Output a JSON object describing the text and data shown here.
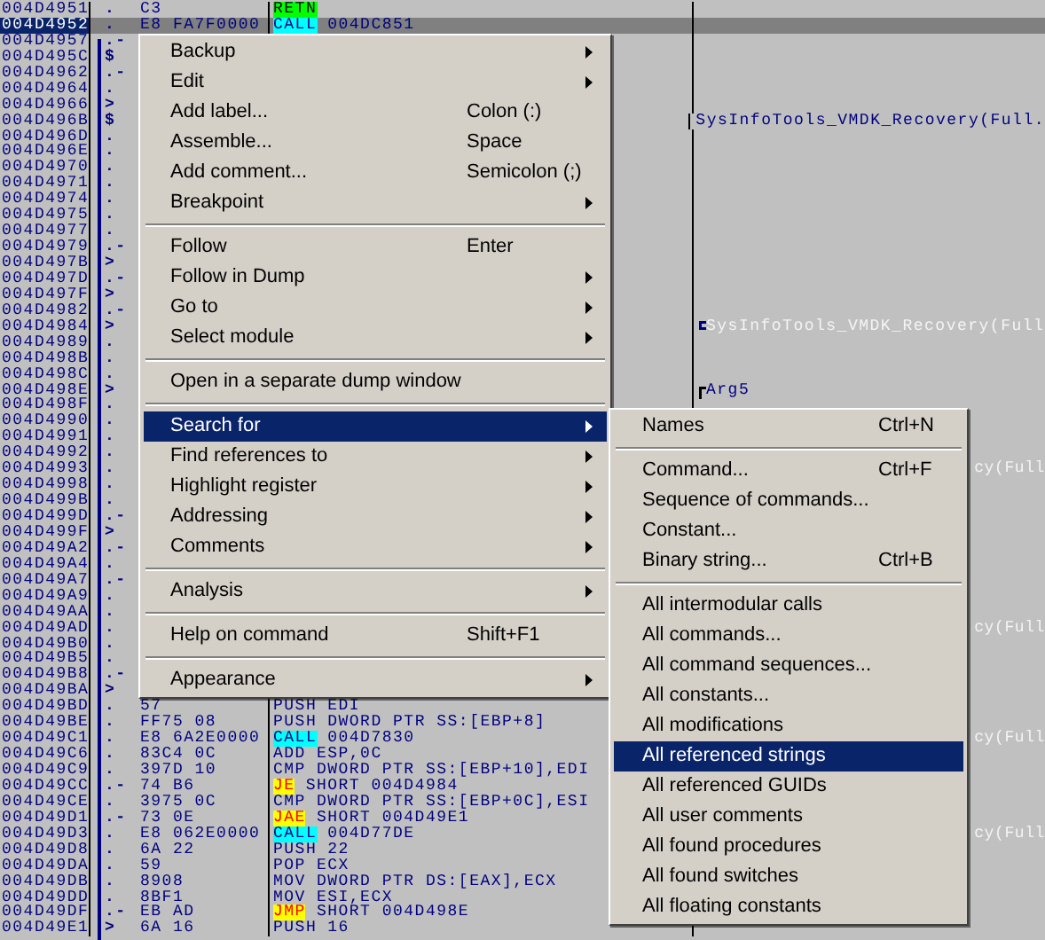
{
  "listing": {
    "rows": [
      {
        "address": "004D4951",
        "mark": ".",
        "hex": "C3",
        "mnemonic": "RETN",
        "operand": "",
        "kind": "ret",
        "selected": false
      },
      {
        "address": "004D4952",
        "mark": ".",
        "hex": "E8 FA7F0000",
        "mnemonic": "CALL",
        "operand": "004DC851",
        "kind": "call",
        "selected": true
      },
      {
        "address": "004D4957",
        "mark": ".-",
        "selected": false
      },
      {
        "address": "004D495C",
        "mark": "$",
        "selected": false
      },
      {
        "address": "004D4962",
        "mark": ".-",
        "selected": false
      },
      {
        "address": "004D4964",
        "mark": ".",
        "selected": false
      },
      {
        "address": "004D4966",
        "mark": ">",
        "selected": false
      },
      {
        "address": "004D496B",
        "mark": "$",
        "comment": {
          "text": "SysInfoTools_VMDK_Recovery(Full.",
          "kind": "label"
        },
        "selected": false
      },
      {
        "address": "004D496D",
        "mark": ".",
        "selected": false
      },
      {
        "address": "004D496E",
        "mark": ".",
        "selected": false
      },
      {
        "address": "004D4970",
        "mark": ".",
        "selected": false
      },
      {
        "address": "004D4971",
        "mark": ".",
        "selected": false
      },
      {
        "address": "004D4974",
        "mark": ".",
        "selected": false
      },
      {
        "address": "004D4975",
        "mark": ".",
        "selected": false
      },
      {
        "address": "004D4977",
        "mark": ".",
        "selected": false
      },
      {
        "address": "004D4979",
        "mark": ".-",
        "selected": false
      },
      {
        "address": "004D497B",
        "mark": ">",
        "selected": false
      },
      {
        "address": "004D497D",
        "mark": ".-",
        "selected": false
      },
      {
        "address": "004D497F",
        "mark": ">",
        "selected": false
      },
      {
        "address": "004D4982",
        "mark": ".-",
        "selected": false
      },
      {
        "address": "004D4984",
        "mark": ">",
        "comment": {
          "text": "SysInfoTools_VMDK_Recovery(Full",
          "kind": "call"
        },
        "selected": false
      },
      {
        "address": "004D4989",
        "mark": ".",
        "selected": false
      },
      {
        "address": "004D498B",
        "mark": ".",
        "selected": false
      },
      {
        "address": "004D498C",
        "mark": ".",
        "selected": false
      },
      {
        "address": "004D498E",
        "mark": ">",
        "comment": {
          "text": "Arg5",
          "kind": "arg"
        },
        "selected": false
      },
      {
        "address": "004D498F",
        "mark": ".",
        "selected": false
      },
      {
        "address": "004D4990",
        "mark": ".",
        "selected": false
      },
      {
        "address": "004D4991",
        "mark": ".",
        "selected": false
      },
      {
        "address": "004D4992",
        "mark": ".",
        "selected": false
      },
      {
        "address": "004D4993",
        "mark": ".",
        "comment": {
          "text": "cy(Full",
          "kind": "tail"
        },
        "selected": false
      },
      {
        "address": "004D4998",
        "mark": ".",
        "selected": false
      },
      {
        "address": "004D499B",
        "mark": ".",
        "selected": false
      },
      {
        "address": "004D499D",
        "mark": ".-",
        "selected": false
      },
      {
        "address": "004D499F",
        "mark": ">",
        "selected": false
      },
      {
        "address": "004D49A2",
        "mark": ".-",
        "selected": false
      },
      {
        "address": "004D49A4",
        "mark": ".",
        "selected": false
      },
      {
        "address": "004D49A7",
        "mark": ".-",
        "selected": false
      },
      {
        "address": "004D49A9",
        "mark": ".",
        "selected": false
      },
      {
        "address": "004D49AA",
        "mark": ".",
        "selected": false
      },
      {
        "address": "004D49AD",
        "mark": ".",
        "comment": {
          "text": "cy(Full",
          "kind": "tail"
        },
        "selected": false
      },
      {
        "address": "004D49B0",
        "mark": ".",
        "selected": false
      },
      {
        "address": "004D49B5",
        "mark": ".",
        "selected": false
      },
      {
        "address": "004D49B8",
        "mark": ".-",
        "selected": false
      },
      {
        "address": "004D49BA",
        "mark": ">",
        "selected": false
      },
      {
        "address": "004D49BD",
        "mark": ".",
        "hex": "57",
        "mnemonic": "PUSH",
        "operand": "EDI",
        "kind": "plain",
        "selected": false
      },
      {
        "address": "004D49BE",
        "mark": ".",
        "hex": "FF75 08",
        "mnemonic": "PUSH",
        "operand": "DWORD PTR SS:[EBP+8]",
        "kind": "plain",
        "selected": false
      },
      {
        "address": "004D49C1",
        "mark": ".",
        "hex": "E8 6A2E0000",
        "mnemonic": "CALL",
        "operand": "004D7830",
        "kind": "call",
        "comment": {
          "text": "cy(Full",
          "kind": "tail"
        },
        "selected": false
      },
      {
        "address": "004D49C6",
        "mark": ".",
        "hex": "83C4 0C",
        "mnemonic": "ADD",
        "operand": "ESP,0C",
        "kind": "plain",
        "selected": false
      },
      {
        "address": "004D49C9",
        "mark": ".",
        "hex": "397D 10",
        "mnemonic": "CMP",
        "operand": "DWORD PTR SS:[EBP+10],EDI",
        "kind": "plain",
        "selected": false
      },
      {
        "address": "004D49CC",
        "mark": ".-",
        "hex": "74 B6",
        "mnemonic": "JE",
        "operand": "SHORT 004D4984",
        "kind": "jump",
        "selected": false
      },
      {
        "address": "004D49CE",
        "mark": ".",
        "hex": "3975 0C",
        "mnemonic": "CMP",
        "operand": "DWORD PTR SS:[EBP+0C],ESI",
        "kind": "plain",
        "selected": false
      },
      {
        "address": "004D49D1",
        "mark": ".-",
        "hex": "73 0E",
        "mnemonic": "JAE",
        "operand": "SHORT 004D49E1",
        "kind": "jump",
        "selected": false
      },
      {
        "address": "004D49D3",
        "mark": ".",
        "hex": "E8 062E0000",
        "mnemonic": "CALL",
        "operand": "004D77DE",
        "kind": "call",
        "comment": {
          "text": "cy(Full",
          "kind": "tail"
        },
        "selected": false
      },
      {
        "address": "004D49D8",
        "mark": ".",
        "hex": "6A 22",
        "mnemonic": "PUSH",
        "operand": "22",
        "kind": "plain",
        "selected": false
      },
      {
        "address": "004D49DA",
        "mark": ".",
        "hex": "59",
        "mnemonic": "POP",
        "operand": "ECX",
        "kind": "plain",
        "selected": false
      },
      {
        "address": "004D49DB",
        "mark": ".",
        "hex": "8908",
        "mnemonic": "MOV",
        "operand": "DWORD PTR DS:[EAX],ECX",
        "kind": "plain",
        "selected": false
      },
      {
        "address": "004D49DD",
        "mark": ".",
        "hex": "8BF1",
        "mnemonic": "MOV",
        "operand": "ESI,ECX",
        "kind": "plain",
        "selected": false
      },
      {
        "address": "004D49DF",
        "mark": ".-",
        "hex": "EB AD",
        "mnemonic": "JMP",
        "operand": "SHORT 004D498E",
        "kind": "jump",
        "selected": false
      },
      {
        "address": "004D49E1",
        "mark": ">",
        "hex": "6A 16",
        "mnemonic": "PUSH",
        "operand": "16",
        "kind": "plain",
        "selected": false
      }
    ]
  },
  "context_menu": {
    "items": [
      {
        "kind": "item",
        "label": "Backup",
        "submenu": true,
        "selected": false
      },
      {
        "kind": "item",
        "label": "Edit",
        "submenu": true,
        "selected": false
      },
      {
        "kind": "item",
        "label": "Add label...",
        "shortcut": "Colon (:)",
        "selected": false
      },
      {
        "kind": "item",
        "label": "Assemble...",
        "shortcut": "Space",
        "selected": false
      },
      {
        "kind": "item",
        "label": "Add comment...",
        "shortcut": "Semicolon (;)",
        "selected": false
      },
      {
        "kind": "item",
        "label": "Breakpoint",
        "submenu": true,
        "selected": false
      },
      {
        "kind": "separator"
      },
      {
        "kind": "item",
        "label": "Follow",
        "shortcut": "Enter",
        "selected": false
      },
      {
        "kind": "item",
        "label": "Follow in Dump",
        "submenu": true,
        "selected": false
      },
      {
        "kind": "item",
        "label": "Go to",
        "submenu": true,
        "selected": false
      },
      {
        "kind": "item",
        "label": "Select module",
        "submenu": true,
        "selected": false
      },
      {
        "kind": "separator"
      },
      {
        "kind": "item",
        "label": "Open in a separate dump window",
        "selected": false
      },
      {
        "kind": "separator"
      },
      {
        "kind": "item",
        "label": "Search for",
        "submenu": true,
        "selected": true
      },
      {
        "kind": "item",
        "label": "Find references to",
        "submenu": true,
        "selected": false
      },
      {
        "kind": "item",
        "label": "Highlight register",
        "submenu": true,
        "selected": false
      },
      {
        "kind": "item",
        "label": "Addressing",
        "submenu": true,
        "selected": false
      },
      {
        "kind": "item",
        "label": "Comments",
        "submenu": true,
        "selected": false
      },
      {
        "kind": "separator"
      },
      {
        "kind": "item",
        "label": "Analysis",
        "submenu": true,
        "selected": false
      },
      {
        "kind": "separator"
      },
      {
        "kind": "item",
        "label": "Help on command",
        "shortcut": "Shift+F1",
        "selected": false
      },
      {
        "kind": "separator"
      },
      {
        "kind": "item",
        "label": "Appearance",
        "submenu": true,
        "selected": false
      }
    ]
  },
  "search_submenu": {
    "items": [
      {
        "kind": "item",
        "label": "Names",
        "shortcut": "Ctrl+N",
        "selected": false
      },
      {
        "kind": "separator"
      },
      {
        "kind": "item",
        "label": "Command...",
        "shortcut": "Ctrl+F",
        "selected": false
      },
      {
        "kind": "item",
        "label": "Sequence of commands...",
        "selected": false
      },
      {
        "kind": "item",
        "label": "Constant...",
        "selected": false
      },
      {
        "kind": "item",
        "label": "Binary string...",
        "shortcut": "Ctrl+B",
        "selected": false
      },
      {
        "kind": "separator"
      },
      {
        "kind": "item",
        "label": "All intermodular calls",
        "selected": false
      },
      {
        "kind": "item",
        "label": "All commands...",
        "selected": false
      },
      {
        "kind": "item",
        "label": "All command sequences...",
        "selected": false
      },
      {
        "kind": "item",
        "label": "All constants...",
        "selected": false
      },
      {
        "kind": "item",
        "label": "All modifications",
        "selected": false
      },
      {
        "kind": "item",
        "label": "All referenced strings",
        "selected": true
      },
      {
        "kind": "item",
        "label": "All referenced GUIDs",
        "selected": false
      },
      {
        "kind": "item",
        "label": "All user comments",
        "selected": false
      },
      {
        "kind": "item",
        "label": "All found procedures",
        "selected": false
      },
      {
        "kind": "item",
        "label": "All found switches",
        "selected": false
      },
      {
        "kind": "item",
        "label": "All floating constants",
        "selected": false
      }
    ]
  }
}
